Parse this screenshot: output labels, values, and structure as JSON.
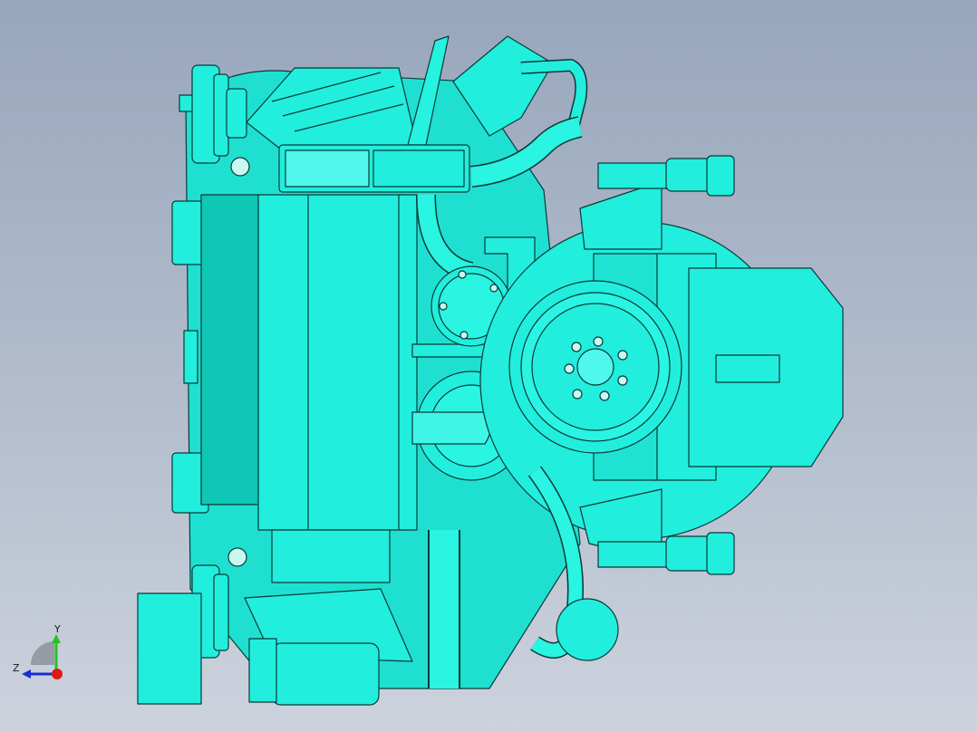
{
  "viewport": {
    "background_top": "#98a6bc",
    "background_bottom": "#cdd3dd",
    "model_fill": "#22eedd",
    "model_shade": "#10c6b4",
    "model_edge": "#0a3a38"
  },
  "triad": {
    "y_label": "Y",
    "z_label": "Z",
    "y_color": "#22c422",
    "z_color": "#1a2fd0",
    "origin_color": "#e01818"
  }
}
